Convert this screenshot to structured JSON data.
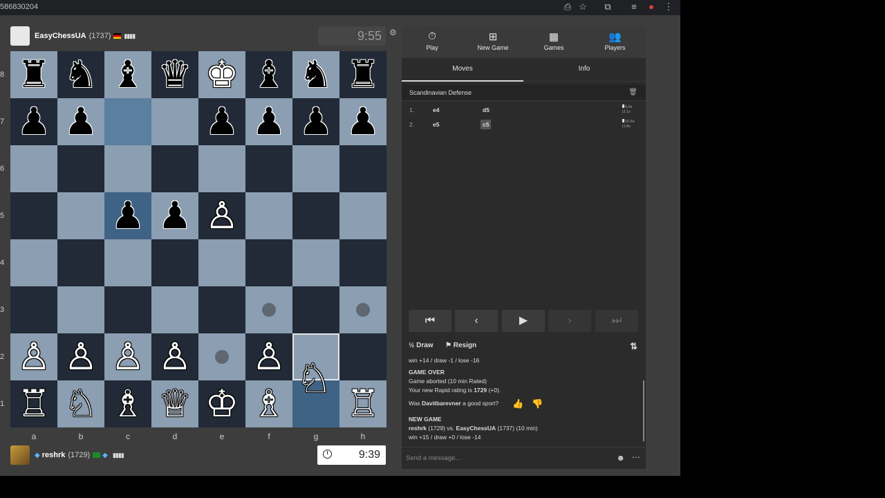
{
  "browser": {
    "url_fragment": "586830204"
  },
  "top_player": {
    "name": "EasyChessUA",
    "rating": "(1737)",
    "clock": "9:55"
  },
  "bottom_player": {
    "name": "reshrk",
    "rating": "(1729)",
    "clock": "9:39"
  },
  "board": {
    "ranks": [
      "8",
      "7",
      "6",
      "5",
      "4",
      "3",
      "2",
      "1"
    ],
    "files": [
      "a",
      "b",
      "c",
      "d",
      "e",
      "f",
      "g",
      "h"
    ],
    "pieces": {
      "8": [
        "♜",
        "♞",
        "♝",
        "♛",
        "♚",
        "♝",
        "♞",
        "♜"
      ],
      "7": [
        "♟",
        "♟",
        "",
        "",
        "♟",
        "♟",
        "♟",
        "♟"
      ],
      "6": [
        "",
        "",
        "",
        "",
        "",
        "",
        "",
        ""
      ],
      "5": [
        "",
        "",
        "♟",
        "♟",
        "♙",
        "",
        "",
        ""
      ],
      "4": [
        "",
        "",
        "",
        "",
        "",
        "",
        "",
        ""
      ],
      "3": [
        "",
        "",
        "",
        "",
        "",
        "",
        "",
        ""
      ],
      "2": [
        "♙",
        "♙",
        "♙",
        "♙",
        "",
        "♙",
        "",
        ""
      ],
      "1": [
        "♖",
        "♘",
        "♗",
        "♕",
        "♔",
        "♗",
        "",
        "♖"
      ]
    },
    "colors": {
      "8": [
        "b",
        "b",
        "b",
        "b",
        "w",
        "b",
        "b",
        "b"
      ],
      "7": [
        "b",
        "b",
        "",
        "",
        "b",
        "b",
        "b",
        "b"
      ],
      "5": [
        "",
        "",
        "b",
        "b",
        "w",
        "",
        "",
        ""
      ],
      "2": [
        "w",
        "w",
        "w",
        "w",
        "",
        "w",
        "w",
        "w"
      ],
      "1": [
        "w",
        "w",
        "w",
        "w",
        "w",
        "w",
        "",
        "w"
      ]
    },
    "dragging_piece": "♘",
    "light_color": "#8b9eb2",
    "dark_color": "#212a36"
  },
  "nav": {
    "items": [
      {
        "label": "Play",
        "icon": "stopwatch-icon"
      },
      {
        "label": "New Game",
        "icon": "plus-icon"
      },
      {
        "label": "Games",
        "icon": "board-icon"
      },
      {
        "label": "Players",
        "icon": "players-icon"
      }
    ]
  },
  "tabs": {
    "moves": "Moves",
    "info": "Info"
  },
  "opening": "Scandinavian Defense",
  "moves": [
    {
      "num": "1.",
      "white": "e4",
      "black": "d5",
      "t1": "6.0s",
      "t2": "2.1s"
    },
    {
      "num": "2.",
      "white": "e5",
      "black": "c5",
      "t1": "10.6s",
      "t2": "1.8s"
    }
  ],
  "actions": {
    "draw": "Draw",
    "draw_symbol": "½",
    "resign": "Resign"
  },
  "chat": {
    "line1": "win +14 / draw -1 / lose -16",
    "game_over": "GAME OVER",
    "aborted": "Game aborted (10 min Rated)",
    "rating_prefix": "Your new Rapid rating is ",
    "rating_value": "1729",
    "rating_suffix": " (+0).",
    "sport_prefix": "Was ",
    "sport_name": "Davitbarevner",
    "sport_suffix": " a good sport?",
    "new_game": "NEW GAME",
    "ng_white": "reshrk",
    "ng_mid": " (1729) vs. ",
    "ng_black": "EasyChessUA",
    "ng_tail": " (1737) (10 min)",
    "ng_odds": "win +15 / draw +0 / lose -14",
    "placeholder": "Send a message..."
  }
}
